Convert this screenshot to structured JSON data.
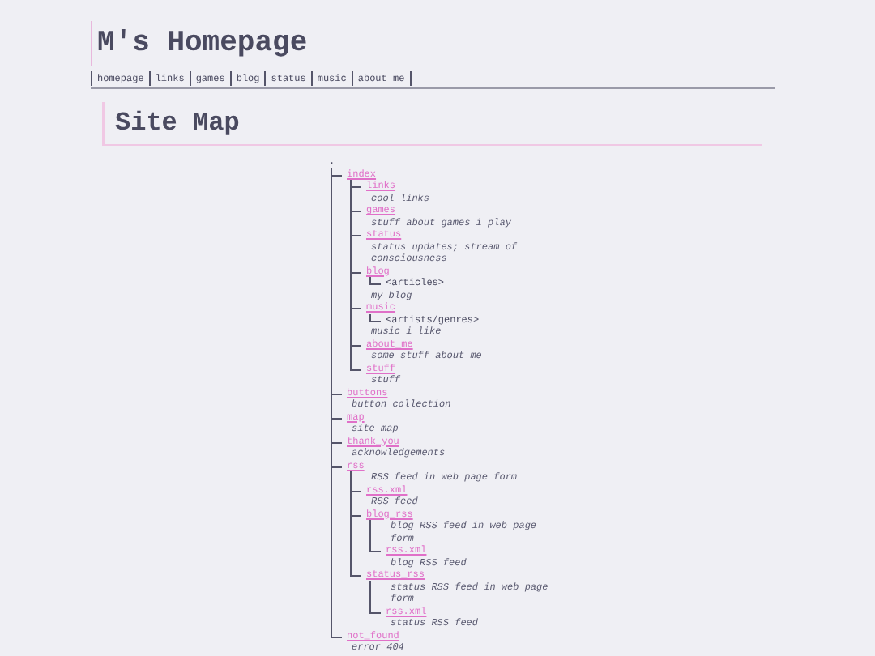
{
  "site_title": "M's Homepage",
  "nav": [
    "homepage",
    "links",
    "games",
    "blog",
    "status",
    "music",
    "about me"
  ],
  "heading": "Site Map",
  "tree": {
    "name": ".",
    "children": [
      {
        "name": "index",
        "kind": "link",
        "children": [
          {
            "name": "links",
            "kind": "link",
            "desc": "cool links"
          },
          {
            "name": "games",
            "kind": "link",
            "desc": "stuff about games i play"
          },
          {
            "name": "status",
            "kind": "link",
            "desc": "status updates; stream of consciousness"
          },
          {
            "name": "blog",
            "kind": "link",
            "desc": "my blog",
            "children": [
              {
                "name": "<articles>",
                "kind": "plain"
              }
            ]
          },
          {
            "name": "music",
            "kind": "link",
            "desc": "music i like",
            "children": [
              {
                "name": "<artists/genres>",
                "kind": "plain"
              }
            ]
          },
          {
            "name": "about_me",
            "kind": "link",
            "desc": "some stuff about me"
          },
          {
            "name": "stuff",
            "kind": "link",
            "desc": "stuff"
          }
        ]
      },
      {
        "name": "buttons",
        "kind": "link",
        "desc": "button collection"
      },
      {
        "name": "map",
        "kind": "link",
        "desc": "site map"
      },
      {
        "name": "thank_you",
        "kind": "link",
        "desc": "acknowledgements"
      },
      {
        "name": "rss",
        "kind": "link",
        "desc": "RSS feed in web page form",
        "children": [
          {
            "name": "rss.xml",
            "kind": "link",
            "desc": "RSS feed"
          },
          {
            "name": "blog_rss",
            "kind": "link",
            "desc": "blog RSS feed in web page form",
            "children": [
              {
                "name": "rss.xml",
                "kind": "link",
                "desc": "blog RSS feed"
              }
            ]
          },
          {
            "name": "status_rss",
            "kind": "link",
            "desc": "status RSS feed in web page form",
            "children": [
              {
                "name": "rss.xml",
                "kind": "link",
                "desc": "status RSS feed"
              }
            ]
          }
        ]
      },
      {
        "name": "not_found",
        "kind": "link",
        "desc": "error 404"
      }
    ]
  }
}
